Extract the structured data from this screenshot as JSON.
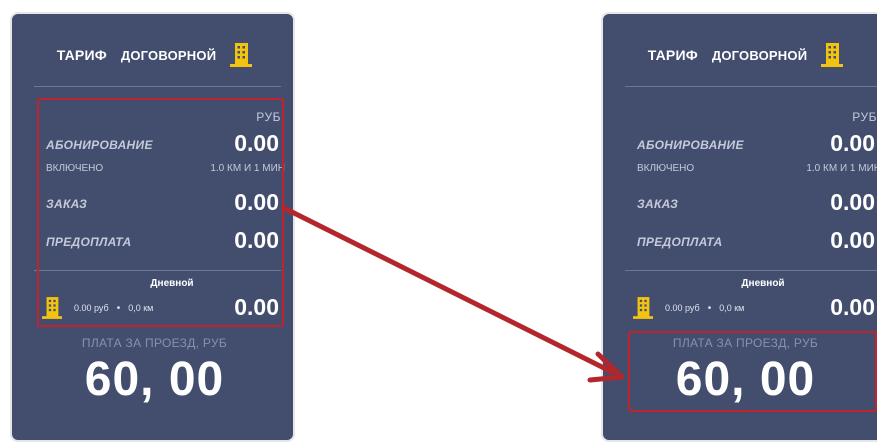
{
  "tariff": {
    "label": "ТАРИФ",
    "name": "ДОГОВОРНОЙ",
    "icon": "building-icon"
  },
  "currency": "РУБ",
  "rows": {
    "subscription": {
      "label": "АБОНИРОВАНИЕ",
      "value": "0.00",
      "sub_label": "ВКЛЮЧЕНО",
      "sub_value": "1.0 КМ И 1 МИН"
    },
    "order": {
      "label": "ЗАКАЗ",
      "value": "0.00"
    },
    "prepay": {
      "label": "ПРЕДОПЛАТА",
      "value": "0.00"
    }
  },
  "period": {
    "name": "Дневной",
    "price": "0.00 руб",
    "distance": "0,0 км",
    "value": "0.00"
  },
  "fare": {
    "label": "ПЛАТА ЗА ПРОЕЗД, РУБ",
    "value": "60, 00"
  },
  "colors": {
    "panel": "#434d6d",
    "highlight": "#c0232b",
    "icon_yellow": "#f2c40f"
  }
}
